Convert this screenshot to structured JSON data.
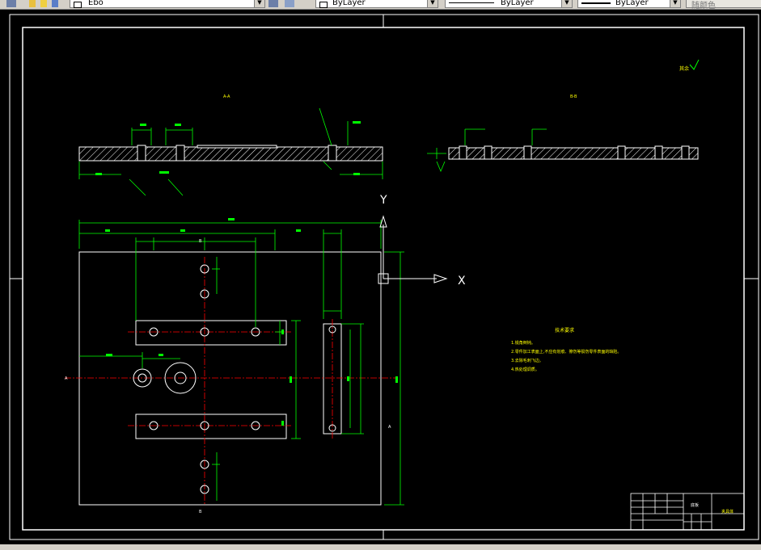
{
  "toolbar": {
    "layer_name": "Ebo",
    "color_value": "ByLayer",
    "linetype_value": "ByLayer",
    "lineweight_value": "ByLayer",
    "plotstyle_value": "随颜色"
  },
  "drawing": {
    "section_a_label": "A-A",
    "section_b_label": "B-B",
    "ucs_y_label": "Y",
    "ucs_x_label": "X",
    "roughness_note": "其余",
    "dim_overall_width": "400",
    "dim_overall_height": "380",
    "tech_req_title": "技术要求",
    "tech_req_items": [
      "1.锐角倒钝。",
      "2.零件加工表面上,不应有划痕、擦伤等损伤零件表面的缺陷。",
      "3.去除毛刺飞边。",
      "4.热处理调质。"
    ],
    "title_block_name": "底板",
    "title_block_company": "夹具体"
  }
}
